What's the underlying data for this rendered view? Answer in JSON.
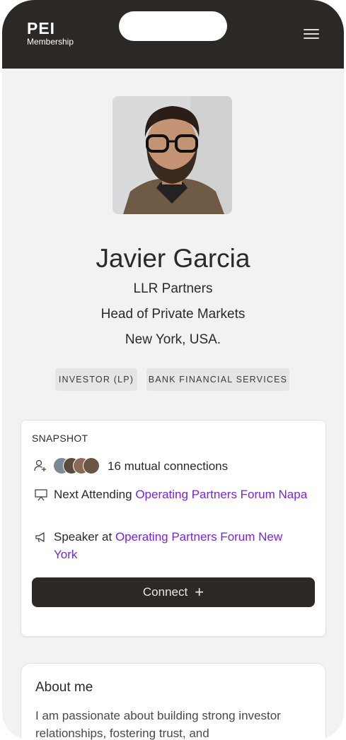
{
  "header": {
    "logo_main": "PEI",
    "logo_sub": "Membership"
  },
  "profile": {
    "name": "Javier Garcia",
    "company": "LLR Partners",
    "title": "Head of Private Markets",
    "location": "New York, USA.",
    "tags": [
      "INVESTOR (LP)",
      "BANK FINANCIAL SERVICES"
    ]
  },
  "snapshot": {
    "title": "SNAPSHOT",
    "mutual_connections": "16 mutual connections",
    "next_attending_prefix": "Next Attending ",
    "next_attending_event": "Operating Partners Forum Napa",
    "speaker_prefix": "Speaker at ",
    "speaker_event": "Operating Partners Forum New York",
    "connect_label": "Connect"
  },
  "about": {
    "title": "About me",
    "text": "I am passionate about building strong investor relationships, fostering trust, and"
  },
  "icons": {
    "menu": "hamburger-menu-icon",
    "connections": "person-add-icon",
    "attending": "presentation-board-icon",
    "speaker": "megaphone-icon",
    "connect": "plus-icon"
  },
  "colors": {
    "header_bg": "#2b2825",
    "page_bg": "#f2f2f2",
    "link": "#7a24d6",
    "button_bg": "#2b2825"
  }
}
